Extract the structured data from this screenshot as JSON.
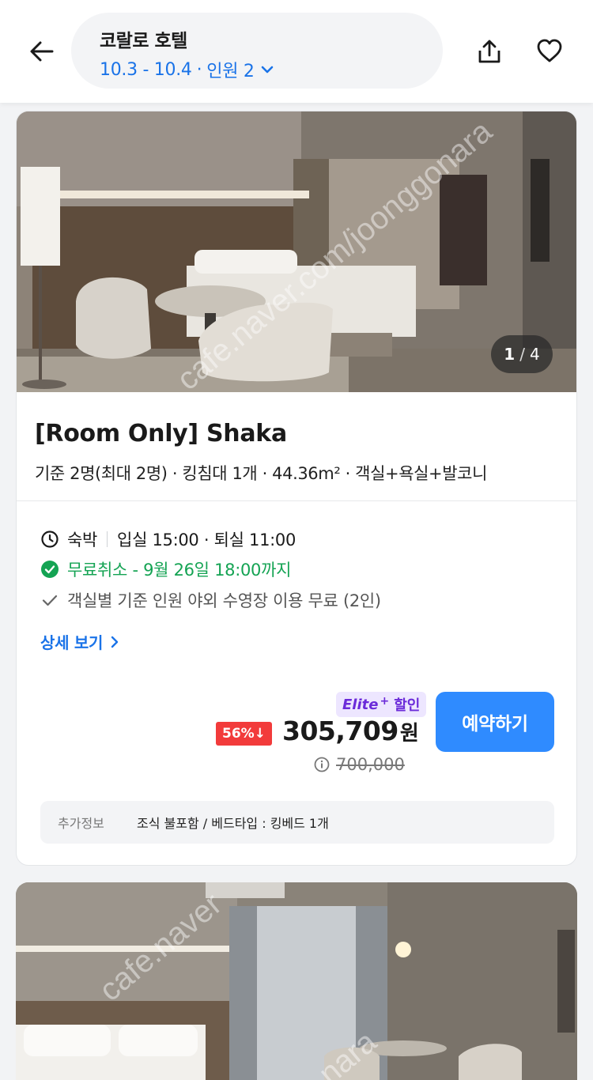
{
  "header": {
    "hotel_name": "코랄로 호텔",
    "dates": "10.3 - 10.4",
    "dot": "·",
    "guests": "인원 2",
    "accent": "#1a73e8"
  },
  "room": {
    "photo_counter": {
      "current": "1",
      "separator": "/",
      "total": "4"
    },
    "title": "[Room Only] Shaka",
    "spec": "기준 2명(최대 2명) · 킹침대 1개 · 44.36m² · 객실+욕실+발코니",
    "stay": {
      "label": "숙박",
      "times": "입실 15:00 · 퇴실 11:00"
    },
    "cancellation": {
      "text": "무료취소 - 9월 26일 18:00까지",
      "color": "#14a353"
    },
    "perk": "객실별 기준 인원 야외 수영장 이용 무료 (2인)",
    "details_link": "상세 보기",
    "badge": {
      "elite": "Elite",
      "plus": "+",
      "label": "할인",
      "color": "#6b2bd9"
    },
    "discount": "56%↓",
    "price": "305,709",
    "currency": "원",
    "original_price": "700,000",
    "book_button": "예약하기",
    "extra_info": {
      "label": "추가정보",
      "value": "조식 불포함 / 베드타입 : 킹베드 1개"
    }
  },
  "watermarks": {
    "site": "cafe.naver.com/joonggonara",
    "site_short": "cafe.naver",
    "site_tail": "nara"
  }
}
